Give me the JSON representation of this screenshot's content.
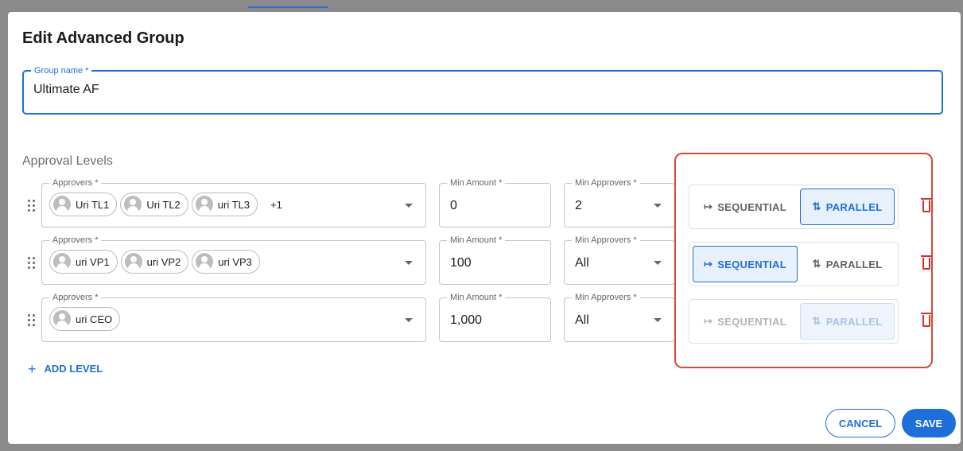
{
  "dialog": {
    "title": "Edit Advanced Group",
    "group_name": {
      "label": "Group name *",
      "value": "Ultimate AF"
    },
    "levels_label": "Approval Levels",
    "levels": [
      {
        "approvers_label": "Approvers *",
        "approvers": [
          "Uri TL1",
          "Uri TL2",
          "uri TL3"
        ],
        "more": "+1",
        "min_amount_label": "Min Amount *",
        "min_amount": "0",
        "min_approvers_label": "Min Approvers *",
        "min_approvers": "2",
        "mode": "parallel"
      },
      {
        "approvers_label": "Approvers *",
        "approvers": [
          "uri VP1",
          "uri VP2",
          "uri VP3"
        ],
        "more": "",
        "min_amount_label": "Min Amount *",
        "min_amount": "100",
        "min_approvers_label": "Min Approvers *",
        "min_approvers": "All",
        "mode": "sequential"
      },
      {
        "approvers_label": "Approvers *",
        "approvers": [
          "uri CEO"
        ],
        "more": "",
        "min_amount_label": "Min Amount *",
        "min_amount": "1,000",
        "min_approvers_label": "Min Approvers *",
        "min_approvers": "All",
        "mode": "parallel",
        "disabled": true
      }
    ],
    "toggle": {
      "sequential_label": "SEQUENTIAL",
      "parallel_label": "PARALLEL"
    },
    "add_level_label": "ADD LEVEL",
    "cancel_label": "CANCEL",
    "save_label": "SAVE"
  },
  "colors": {
    "accent": "#1e6fd9",
    "danger": "#d32f2f",
    "highlight": "#d9473a"
  },
  "icons": [
    "drag-handle-icon",
    "avatar-icon",
    "caret-down-icon",
    "sequential-icon",
    "parallel-icon",
    "trash-icon",
    "plus-icon"
  ]
}
